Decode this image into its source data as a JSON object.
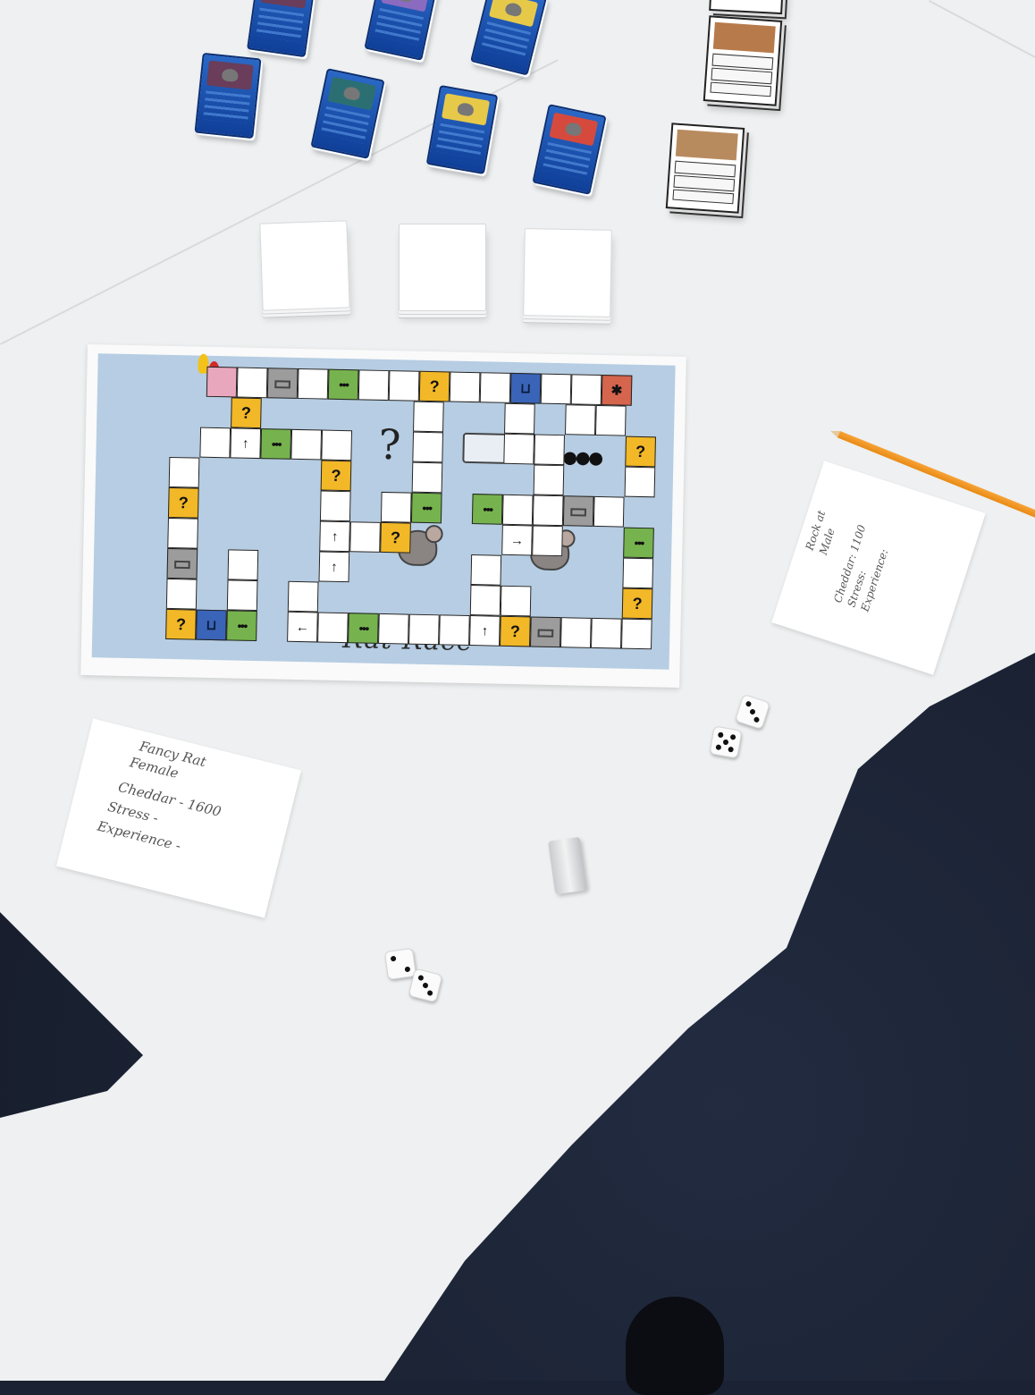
{
  "board": {
    "title": "Rat Race",
    "tile_icons": {
      "question": "question-mark",
      "people": "people-group-icon",
      "briefcase": "briefcase-icon",
      "cart": "shopping-cart-icon",
      "arrow": "arrow-icon"
    },
    "colors": {
      "board_bg": "#b6cde3",
      "question_tile": "#f2b827",
      "people_tile": "#76b34e",
      "briefcase_tile": "#9c9c9c",
      "cart_tile": "#3a64b7",
      "start_tile": "#e9a7bd",
      "end_tile": "#d6654e"
    }
  },
  "player_card_1": {
    "line1": "Fancy Rat",
    "line2": "Female",
    "line3": "Cheddar - 1600",
    "line4": "Stress -",
    "line5": "Experience -"
  },
  "player_card_2": {
    "line1": "Rock at",
    "line2": "Male",
    "line3": "Cheddar: 1100",
    "line4": "Stress:",
    "line5": "Experience:"
  },
  "dice": [
    {
      "name": "die-right-top",
      "value": 3
    },
    {
      "name": "die-right-bottom",
      "value": 5
    },
    {
      "name": "die-bottom-left",
      "value": 2
    },
    {
      "name": "die-bottom-right",
      "value": 3
    }
  ],
  "pieces": {
    "pawn_colors": [
      "#f2c21b",
      "#d42a2a"
    ]
  }
}
